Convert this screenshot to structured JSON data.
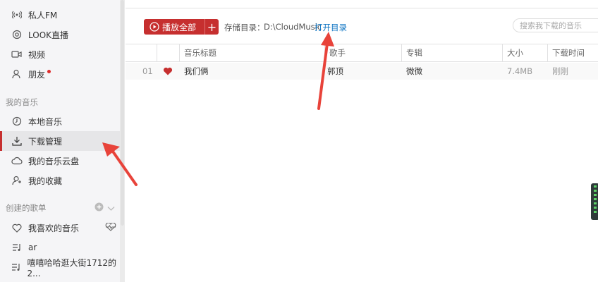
{
  "sidebar": {
    "top_items": [
      {
        "label": "私人FM",
        "icon": "radio-icon"
      },
      {
        "label": "LOOK直播",
        "icon": "live-icon"
      },
      {
        "label": "视频",
        "icon": "video-icon"
      },
      {
        "label": "朋友",
        "icon": "friends-icon",
        "badge": true
      }
    ],
    "my_music_heading": "我的音乐",
    "my_music_items": [
      {
        "label": "本地音乐",
        "icon": "local-music-icon"
      },
      {
        "label": "下载管理",
        "icon": "download-icon",
        "active": true
      },
      {
        "label": "我的音乐云盘",
        "icon": "cloud-icon"
      },
      {
        "label": "我的收藏",
        "icon": "collection-icon"
      }
    ],
    "playlists_heading": "创建的歌单",
    "playlists": [
      {
        "label": "我喜欢的音乐",
        "icon": "heart-outline-icon"
      },
      {
        "label": "ar",
        "icon": "playlist-icon"
      },
      {
        "label": "嘻嘻哈哈逛大街1712的2...",
        "icon": "playlist-icon"
      }
    ]
  },
  "toolbar": {
    "play_all_label": "播放全部",
    "add_label": "+",
    "storage_label": "存储目录：",
    "storage_path": "D:\\CloudMusic",
    "open_dir_label": "打开目录",
    "search_placeholder": "搜索我下载的音乐"
  },
  "table": {
    "columns": [
      "音乐标题",
      "歌手",
      "专辑",
      "大小",
      "下载时间"
    ],
    "rows": [
      {
        "index": "01",
        "liked": true,
        "title": "我们俩",
        "artist": "郭顶",
        "album": "微微",
        "size": "7.4MB",
        "time": "刚刚"
      }
    ]
  },
  "colors": {
    "accent": "#c62f2f",
    "link": "#0c73c2",
    "annotation_arrow": "#e8433a"
  }
}
